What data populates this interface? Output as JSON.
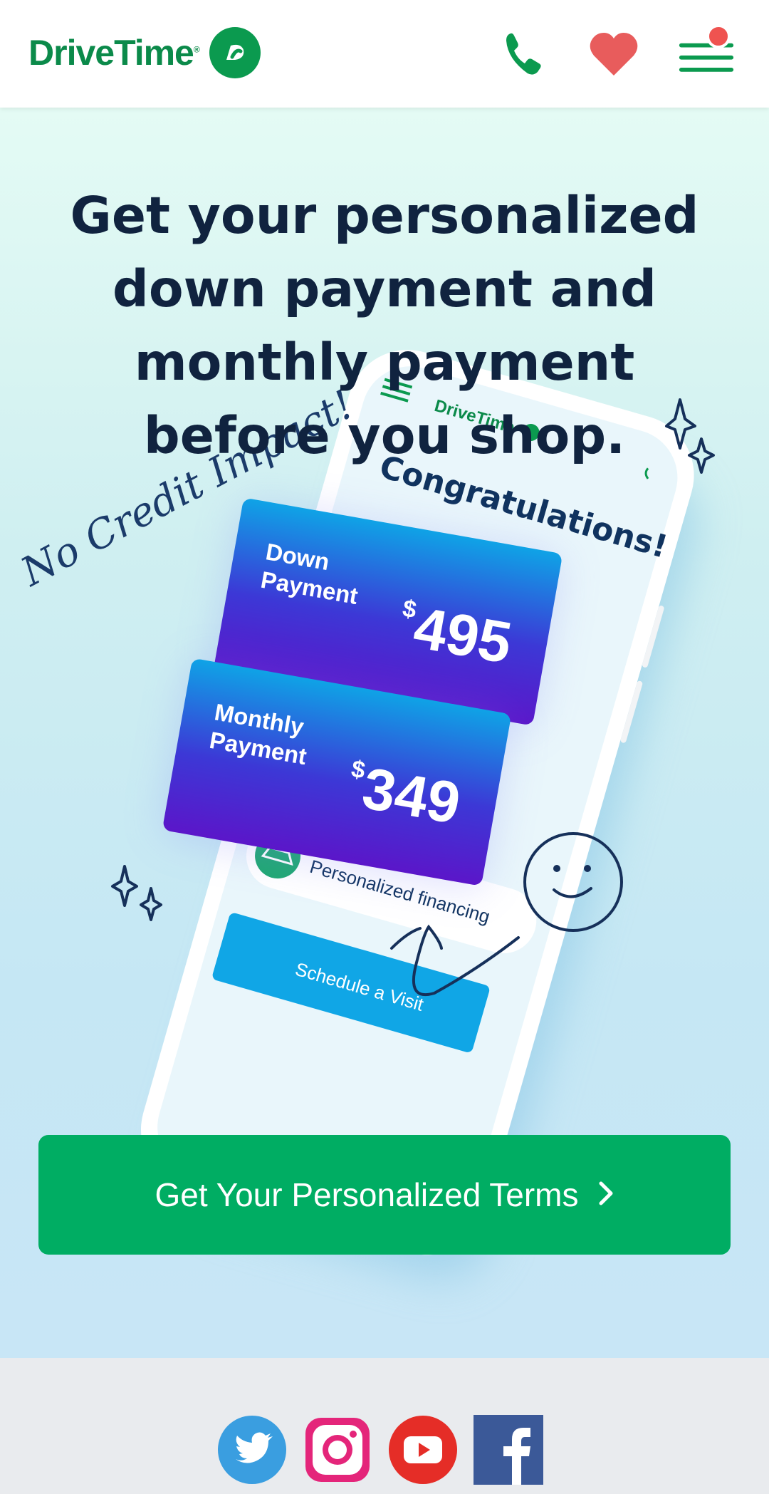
{
  "brand": {
    "name": "DriveTime",
    "reg_mark": "®",
    "green": "#0b9a4f",
    "navy": "#10233f"
  },
  "header": {
    "phone_icon": "phone-icon",
    "favorites_icon": "heart-icon",
    "menu_icon": "hamburger-menu-icon",
    "notification_color": "#ef5350"
  },
  "hero": {
    "headline": "Get your personalized down payment and monthly payment before you shop.",
    "handwriting": "No Credit Impact!",
    "phone_screen": {
      "logo": "DriveTime",
      "title": "Congratulations!",
      "down_payment_label_1": "Down",
      "down_payment_label_2": "Payment",
      "down_payment_currency": "$",
      "down_payment_value": "495",
      "monthly_payment_label_1": "Monthly",
      "monthly_payment_label_2": "Payment",
      "monthly_payment_currency": "$",
      "monthly_payment_value": "349",
      "financing_label": "Personalized financing",
      "schedule_button": "Schedule a Visit"
    }
  },
  "cta": {
    "label": "Get Your Personalized Terms",
    "color": "#00ad63"
  },
  "footer": {
    "socials": [
      {
        "name": "twitter",
        "icon": "twitter-icon",
        "color": "#1da1f2"
      },
      {
        "name": "instagram",
        "icon": "instagram-icon",
        "color": "#e4257a"
      },
      {
        "name": "youtube",
        "icon": "youtube-icon",
        "color": "#e52d27"
      },
      {
        "name": "facebook",
        "icon": "facebook-icon",
        "color": "#3b5998"
      }
    ]
  }
}
